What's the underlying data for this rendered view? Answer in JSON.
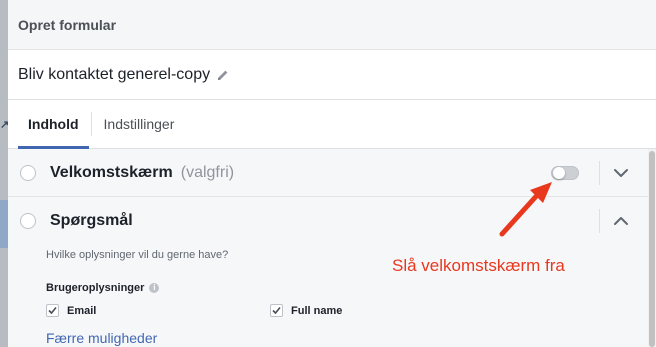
{
  "dialog": {
    "title": "Opret formular"
  },
  "form": {
    "name": "Bliv kontaktet generel-copy",
    "edit_icon": "pencil-icon"
  },
  "tabs": [
    {
      "label": "Indhold",
      "active": true
    },
    {
      "label": "Indstillinger",
      "active": false
    }
  ],
  "sections": {
    "welcome": {
      "title": "Velkomstskærm",
      "optional": "(valgfri)",
      "toggle_on": false,
      "chevron": "chevron-down-icon"
    },
    "questions": {
      "title": "Spørgsmål",
      "chevron": "chevron-up-icon",
      "hint": "Hvilke oplysninger vil du gerne have?",
      "user_info_label": "Brugeroplysninger",
      "info_icon": "info-icon",
      "fields": [
        {
          "label": "Email",
          "checked": true
        },
        {
          "label": "Full name",
          "checked": true
        }
      ],
      "fewer_link": "Færre muligheder"
    }
  },
  "annotation": {
    "text": "Slå velkomstskærm fra",
    "color": "#e8381e"
  },
  "colors": {
    "accent": "#4267b2",
    "annotation": "#e8381e"
  }
}
